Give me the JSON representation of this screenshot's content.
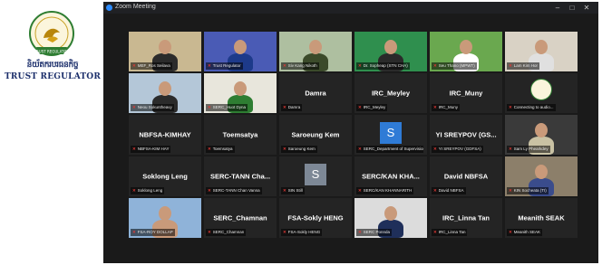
{
  "logo": {
    "emblem_icon": "trust-regulator-emblem-icon",
    "khmer_text": "និយ័តករបរធនកិច្ច",
    "english_text": "TRUST REGULATOR",
    "emblem_ribbon_text": "TRUST REGULATOR"
  },
  "window": {
    "title": "Zoom Meeting",
    "minimize": "–",
    "maximize": "□",
    "close": "✕"
  },
  "tiles": [
    {
      "type": "video",
      "label": "MEF_Ros Seilava"
    },
    {
      "type": "video",
      "label": "Trust Regulator"
    },
    {
      "type": "video",
      "label": "Siv Kang Nikoth"
    },
    {
      "type": "video",
      "label": "Dr. Sopheap (STN CHA)"
    },
    {
      "type": "video",
      "label": "Seu Thano (MPWT)"
    },
    {
      "type": "video",
      "label": "Lam Kim Hor"
    },
    {
      "type": "video",
      "label": "Neou Sokuntheavy"
    },
    {
      "type": "video",
      "label": "SERC_Huot Dyna"
    },
    {
      "type": "name",
      "name": "Damra",
      "label": "Damra"
    },
    {
      "type": "name",
      "name": "IRC_Meyley",
      "label": "IRC_Meyley"
    },
    {
      "type": "name",
      "name": "IRC_Muny",
      "label": "IRC_Muny"
    },
    {
      "type": "logo",
      "label": "Connecting to audio..."
    },
    {
      "type": "name",
      "name": "NBFSA-KIMHAY",
      "label": "NBFSA-KIM HAY"
    },
    {
      "type": "name",
      "name": "Toemsatya",
      "label": "Toemsatya"
    },
    {
      "type": "name",
      "name": "Saroeung Kem",
      "label": "Saroeung Kem"
    },
    {
      "type": "avatar",
      "initial": "S",
      "label": "SERC_Department of Supervision"
    },
    {
      "type": "name",
      "name": "YI SREYPOV (GS...",
      "label": "YI SREYPOV (GDFSA)"
    },
    {
      "type": "video",
      "label": "Sam Ly Phearkdey"
    },
    {
      "type": "name",
      "name": "Soklong Leng",
      "label": "Soklong Leng"
    },
    {
      "type": "name",
      "name": "SERC-TANN Cha...",
      "label": "SERC-TANN Chan Vanna"
    },
    {
      "type": "avatar",
      "initial": "S",
      "label": "SIN Still"
    },
    {
      "type": "name",
      "name": "SERC/KAN KHA...",
      "label": "SERC/KAN KHANNARITH"
    },
    {
      "type": "name",
      "name": "David NBFSA",
      "label": "David NBFSA"
    },
    {
      "type": "video",
      "label": "KIN Socheata (TI)"
    },
    {
      "type": "video",
      "label": "FSA-ROY DOLLAP"
    },
    {
      "type": "name",
      "name": "SERC_Chamnan",
      "label": "SERC_Chamnan"
    },
    {
      "type": "name",
      "name": "FSA-Sokly HENG",
      "label": "FSA-Sokly HENG"
    },
    {
      "type": "video",
      "label": "SERC Ponnda"
    },
    {
      "type": "name",
      "name": "IRC_Linna Tan",
      "label": "IRC_Linna Tan"
    },
    {
      "type": "name",
      "name": "Meanith SEAK",
      "label": "Meanith SEAK"
    }
  ],
  "colors": {
    "tile_bg": "#242424",
    "active_speaker_border": "#e6d84a",
    "muted_mic": "#e53935",
    "logo_text": "#1c2f6b",
    "avatar_blue": "#2f7bd6"
  },
  "icons": {
    "muted_mic": "muted-microphone-icon",
    "app": "zoom-app-icon"
  }
}
